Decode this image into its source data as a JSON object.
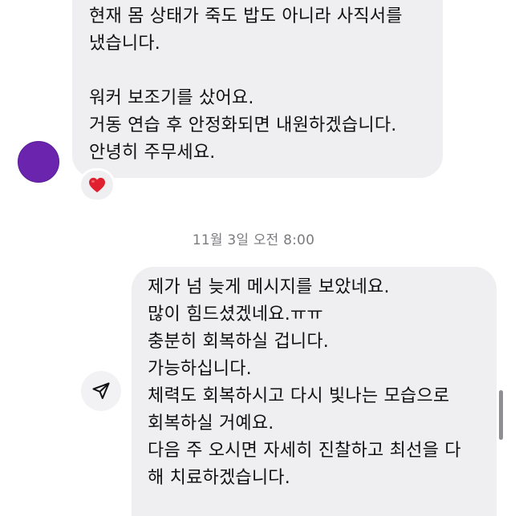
{
  "incoming_message": {
    "lines": [
      "현재 몸 상태가 죽도 밥도 아니라 사직서를",
      "냈습니다.",
      "",
      "워커 보조기를 샀어요.",
      "거동 연습 후 안정화되면 내원하겠습니다.",
      "안녕히 주무세요."
    ],
    "reaction": "❤️"
  },
  "avatar_color": "#6a24ae",
  "timestamp": "11월 3일 오전 8:00",
  "outgoing_message": {
    "lines": [
      "제가 넘 늦게 메시지를 보았네요.",
      "많이 힘드셨겠네요.ㅠㅠ",
      "충분히 회복하실 겁니다.",
      "가능하십니다.",
      "체력도 회복하시고 다시 빛나는 모습으로",
      "회복하실 거예요.",
      "다음 주 오시면 자세히 진찰하고 최선을 다",
      "해 치료하겠습니다."
    ]
  },
  "icons": {
    "share": "share-icon",
    "reaction": "heart-icon"
  },
  "colors": {
    "bubble": "#efeff1",
    "timestamp": "#7b7b80",
    "heart": "#e0202f"
  }
}
